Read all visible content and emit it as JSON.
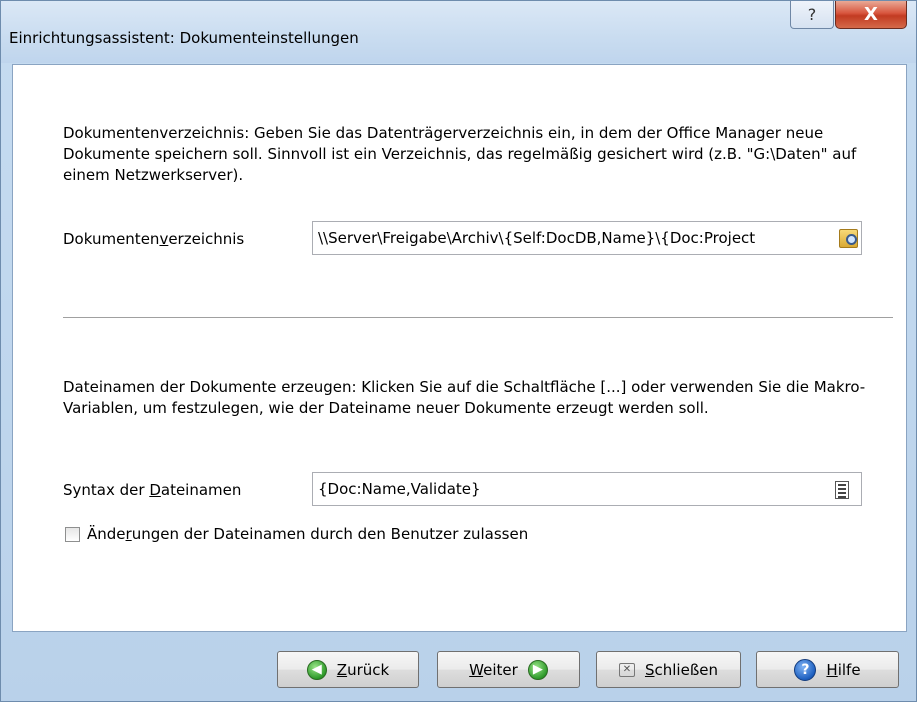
{
  "window": {
    "title": "Einrichtungsassistent: Dokumenteinstellungen",
    "help_glyph": "?",
    "close_glyph": "X"
  },
  "section1": {
    "description": "Dokumentenverzeichnis: Geben Sie das Datenträgerverzeichnis ein, in dem der Office Manager neue Dokumente speichern soll. Sinnvoll ist ein Verzeichnis, das regelmäßig gesichert wird (z.B. \"G:\\Daten\" auf einem Netzwerkserver).",
    "label_pre": "Dokumenten",
    "label_u": "v",
    "label_post": "erzeichnis",
    "value": "\\\\Server\\Freigabe\\Archiv\\{Self:DocDB,Name}\\{Doc:Project"
  },
  "section2": {
    "description": "Dateinamen der Dokumente erzeugen: Klicken Sie auf die Schaltfläche [...] oder verwenden Sie die Makro-Variablen, um festzulegen, wie der Dateiname neuer Dokumente erzeugt werden soll.",
    "label_pre": "Syntax der ",
    "label_u": "D",
    "label_post": "ateinamen",
    "value": "{Doc:Name,Validate}",
    "checkbox_pre": "Ände",
    "checkbox_u": "r",
    "checkbox_post": "ungen der Dateinamen durch den Benutzer zulassen",
    "checkbox_checked": false
  },
  "buttons": {
    "back": {
      "u": "Z",
      "rest": "urück",
      "icon": "arrow-left-icon"
    },
    "next": {
      "u": "W",
      "rest": "eiter",
      "icon": "arrow-right-icon"
    },
    "close": {
      "u": "S",
      "rest": "chließen",
      "icon": "close-x-icon"
    },
    "help": {
      "u": "H",
      "rest": "ilfe",
      "icon": "help-icon"
    }
  }
}
